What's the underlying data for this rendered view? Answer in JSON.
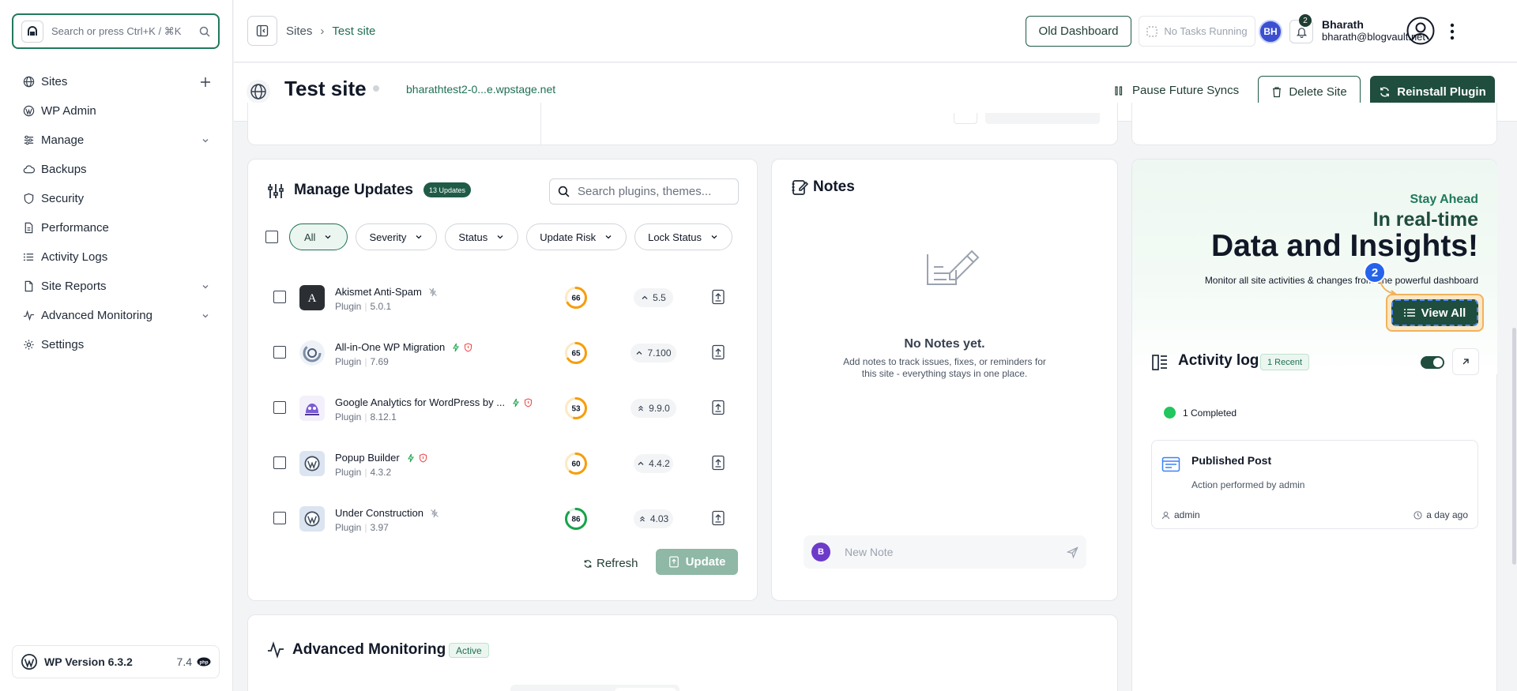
{
  "search": {
    "placeholder": "Search or press Ctrl+K / ⌘K"
  },
  "sidebar": {
    "items": [
      {
        "label": "Sites"
      },
      {
        "label": "WP Admin"
      },
      {
        "label": "Manage"
      },
      {
        "label": "Backups"
      },
      {
        "label": "Security"
      },
      {
        "label": "Performance"
      },
      {
        "label": "Activity Logs"
      },
      {
        "label": "Site Reports"
      },
      {
        "label": "Advanced Monitoring"
      },
      {
        "label": "Settings"
      }
    ],
    "wp_version_label": "WP Version 6.3.2",
    "php_version": "7.4"
  },
  "header": {
    "breadcrumb_root": "Sites",
    "breadcrumb_sep": "›",
    "breadcrumb_current": "Test site",
    "old_dashboard": "Old Dashboard",
    "tasks": "No Tasks Running",
    "avatar_initials": "BH",
    "notifications": "2",
    "user_name": "Bharath",
    "user_email": "bharath@blogvault.net"
  },
  "site": {
    "title": "Test site",
    "url": "bharathtest2-0...e.wpstage.net",
    "pause": "Pause Future Syncs",
    "delete": "Delete Site",
    "reinstall": "Reinstall Plugin"
  },
  "updates": {
    "title": "Manage Updates",
    "badge": "13 Updates",
    "search_placeholder": "Search plugins, themes...",
    "filters": [
      "All",
      "Severity",
      "Status",
      "Update Risk",
      "Lock Status"
    ],
    "type_label": "Plugin",
    "plugins": [
      {
        "name": "Akismet Anti-Spam",
        "version": "5.0.1",
        "score": "66",
        "score_pct": 66,
        "score_color": "#f59e0b",
        "new_version": "5.5",
        "icon": "akismet-icon"
      },
      {
        "name": "All-in-One WP Migration",
        "version": "7.69",
        "score": "65",
        "score_pct": 65,
        "score_color": "#f59e0b",
        "new_version": "7.100",
        "icon": "migration-icon"
      },
      {
        "name": "Google Analytics for WordPress by ...",
        "version": "8.12.1",
        "score": "53",
        "score_pct": 53,
        "score_color": "#f59e0b",
        "new_version": "9.9.0",
        "icon": "monsterinsights-icon"
      },
      {
        "name": "Popup Builder",
        "version": "4.3.2",
        "score": "60",
        "score_pct": 60,
        "score_color": "#f59e0b",
        "new_version": "4.4.2",
        "icon": "wordpress-icon"
      },
      {
        "name": "Under Construction",
        "version": "3.97",
        "score": "86",
        "score_pct": 86,
        "score_color": "#16a34a",
        "new_version": "4.03",
        "icon": "wordpress-icon"
      }
    ],
    "refresh": "Refresh",
    "update": "Update"
  },
  "notes": {
    "title": "Notes",
    "empty_title": "No Notes yet.",
    "empty_desc": "Add notes to track issues, fixes, or reminders for this site - everything stays in one place.",
    "avatar": "B",
    "placeholder": "New Note"
  },
  "promo": {
    "line1": "Stay Ahead",
    "line2": "In real-time",
    "line3": "Data and Insights!",
    "line4": "Monitor all site activities & changes from one powerful dashboard",
    "view_all": "View All",
    "step": "2"
  },
  "activity": {
    "title": "Activity log",
    "badge": "1 Recent",
    "completed": "1 Completed",
    "item_title": "Published Post",
    "item_desc": "Action performed by admin",
    "item_user": "admin",
    "item_time": "a day ago"
  },
  "monitoring": {
    "title": "Advanced Monitoring",
    "badge": "Active"
  },
  "colors": {
    "brand": "#1f4d3e",
    "accent": "#1f7a5c",
    "warning": "#f59e0b",
    "success": "#22c55e"
  }
}
